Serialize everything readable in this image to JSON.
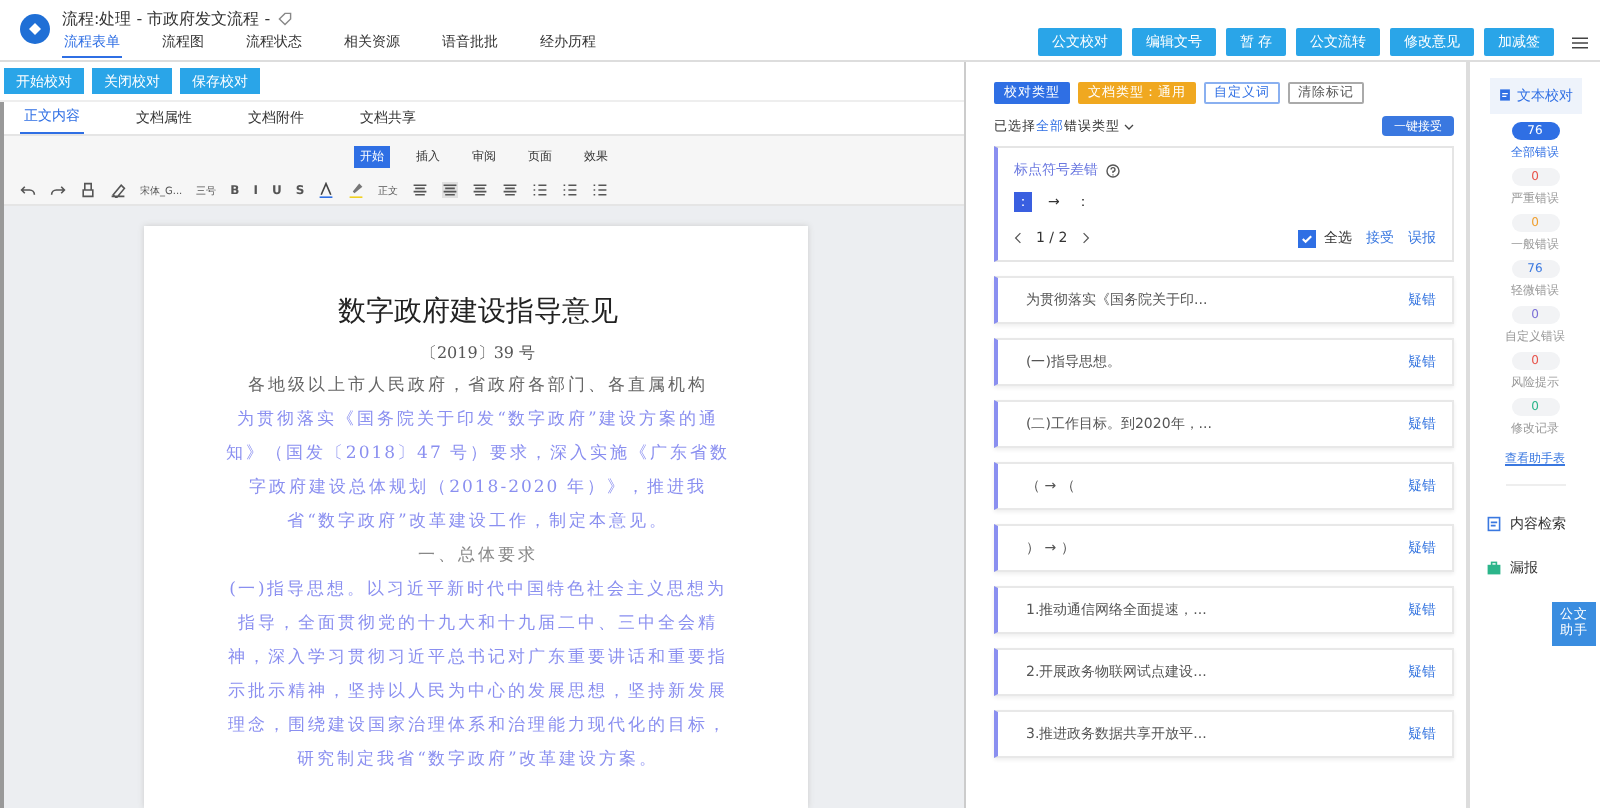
{
  "app": {
    "title": "流程:处理 - 市政府发文流程 -"
  },
  "nav_tabs": [
    {
      "label": "流程表单",
      "selected": true
    },
    {
      "label": "流程图",
      "selected": false
    },
    {
      "label": "流程状态",
      "selected": false
    },
    {
      "label": "相关资源",
      "selected": false
    },
    {
      "label": "语音批批",
      "selected": false
    },
    {
      "label": "经办历程",
      "selected": false
    }
  ],
  "header_buttons": [
    "公文校对",
    "编辑文号",
    "暂 存",
    "公文流转",
    "修改意见",
    "加减签"
  ],
  "proof_buttons": [
    "开始校对",
    "关闭校对",
    "保存校对"
  ],
  "doc_tabs": [
    {
      "label": "正文内容",
      "selected": true
    },
    {
      "label": "文档属性",
      "selected": false
    },
    {
      "label": "文档附件",
      "selected": false
    },
    {
      "label": "文档共享",
      "selected": false
    }
  ],
  "ribbon_tabs": [
    {
      "label": "开始",
      "selected": true
    },
    {
      "label": "插入",
      "selected": false
    },
    {
      "label": "审阅",
      "selected": false
    },
    {
      "label": "页面",
      "selected": false
    },
    {
      "label": "效果",
      "selected": false
    }
  ],
  "toolbar": {
    "font": "宋体_G...",
    "size": "三号",
    "format": [
      "B",
      "I",
      "U",
      "S"
    ],
    "style": "正文"
  },
  "document": {
    "title": "数字政府建设指导意见",
    "number": "〔2019〕39 号",
    "paragraphs": [
      {
        "kind": "salutation",
        "text": "各地级以上市人民政府，省政府各部门、各直属机构"
      },
      {
        "kind": "marked",
        "text": "为贯彻落实《国务院关于印发“数字政府”建设方案的通知》（国发〔2018〕47 号）要求，深入实施《广东省数字政府建设总体规划（2018-2020 年）》，推进我省“数字政府”改革建设工作，制定本意见。"
      },
      {
        "kind": "heading",
        "text": "一、总体要求"
      },
      {
        "kind": "marked",
        "text": "(一)指导思想。以习近平新时代中国特色社会主义思想为指导，全面贯彻党的十九大和十九届二中、三中全会精神，深入学习贯彻习近平总书记对广东重要讲话和重要指示批示精神，坚持以人民为中心的发展思想，坚持新发展理念，围绕建设国家治理体系和治理能力现代化的目标，研究制定我省“数字政府”改革建设方案。"
      }
    ]
  },
  "proof_panel": {
    "filters": [
      {
        "kind": "primary",
        "label": "校对类型"
      },
      {
        "kind": "warning",
        "label": "文档类型：通用"
      },
      {
        "kind": "outline",
        "label": "自定义词"
      },
      {
        "kind": "plain",
        "label": "清除标记"
      }
    ],
    "selection": {
      "prefix": "已选择",
      "highlight": "全部",
      "suffix": "错误类型"
    },
    "accept_all": "一键接受",
    "group": {
      "title": "标点符号差错",
      "from": "：",
      "arrow": "→",
      "to": "：",
      "page": "1 / 2",
      "select_all": {
        "label": "全选",
        "checked": true
      },
      "actions": [
        "接受",
        "误报"
      ]
    },
    "items": [
      {
        "text": "为贯彻落实《国务院关于印...",
        "action": "疑错"
      },
      {
        "text": "(一)指导思想。",
        "action": "疑错"
      },
      {
        "text": "(二)工作目标。到2020年，...",
        "action": "疑错"
      },
      {
        "text": "（  →  （",
        "action": "疑错"
      },
      {
        "text": "）  →  ）",
        "action": "疑错"
      },
      {
        "text": "1.推动通信网络全面提速，...",
        "action": "疑错"
      },
      {
        "text": "2.开展政务物联网试点建设...",
        "action": "疑错"
      },
      {
        "text": "3.推进政务数据共享开放平...",
        "action": "疑错"
      }
    ]
  },
  "stats_panel": {
    "title": "文本校对",
    "stats": [
      {
        "count": "76",
        "label": "全部错误",
        "selected": true,
        "color": "#2f6fe4"
      },
      {
        "count": "0",
        "label": "严重错误",
        "selected": false,
        "color": "#e8534a"
      },
      {
        "count": "0",
        "label": "一般错误",
        "selected": false,
        "color": "#f0a030"
      },
      {
        "count": "76",
        "label": "轻微错误",
        "selected": false,
        "color": "#3a78e0"
      },
      {
        "count": "0",
        "label": "自定义错误",
        "selected": false,
        "color": "#7b6fd6"
      },
      {
        "count": "0",
        "label": "风险提示",
        "selected": false,
        "color": "#e8534a"
      },
      {
        "count": "0",
        "label": "修改记录",
        "selected": false,
        "color": "#2bb58a"
      }
    ],
    "link": "查看助手表",
    "search": "内容检索",
    "report": "漏报",
    "assistant": "公文助手"
  }
}
